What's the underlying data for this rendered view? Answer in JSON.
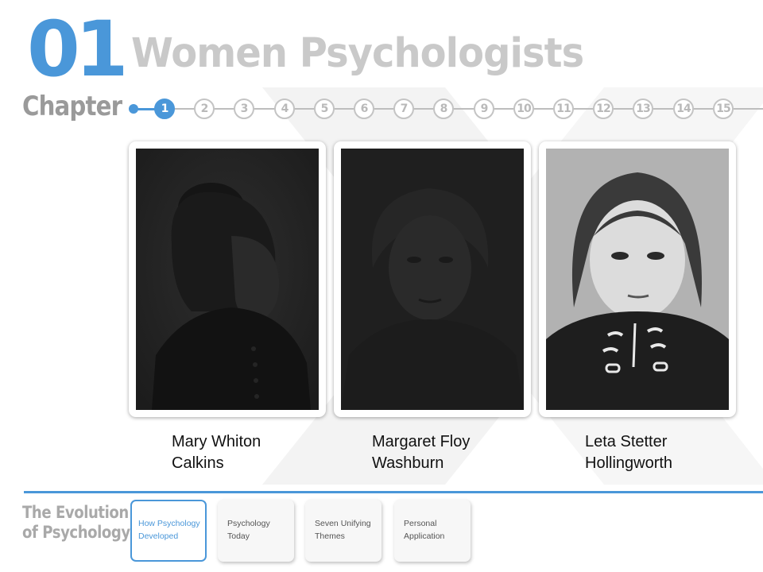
{
  "chapter": {
    "number": "01",
    "label": "Chapter"
  },
  "page": {
    "title": "Women Psychologists"
  },
  "timeline": {
    "chapters": [
      "1",
      "2",
      "3",
      "4",
      "5",
      "6",
      "7",
      "8",
      "9",
      "10",
      "11",
      "12",
      "13",
      "14",
      "15"
    ],
    "active": "1"
  },
  "photos": [
    {
      "name": "Mary Whiton\nCalkins"
    },
    {
      "name": "Margaret Floy\nWashburn"
    },
    {
      "name": "Leta Stetter\nHollingworth"
    }
  ],
  "book": {
    "title": "The Evolution\nof Psychology"
  },
  "sections": [
    {
      "label": "How Psychology\nDeveloped",
      "active": true
    },
    {
      "label": "Psychology\nToday",
      "active": false
    },
    {
      "label": "Seven Unifying\nThemes",
      "active": false
    },
    {
      "label": "Personal\nApplication",
      "active": false
    }
  ],
  "colors": {
    "accent": "#4a97d9",
    "title_gray": "#c9c9c9",
    "chapter_gray": "#9a9a9a"
  }
}
